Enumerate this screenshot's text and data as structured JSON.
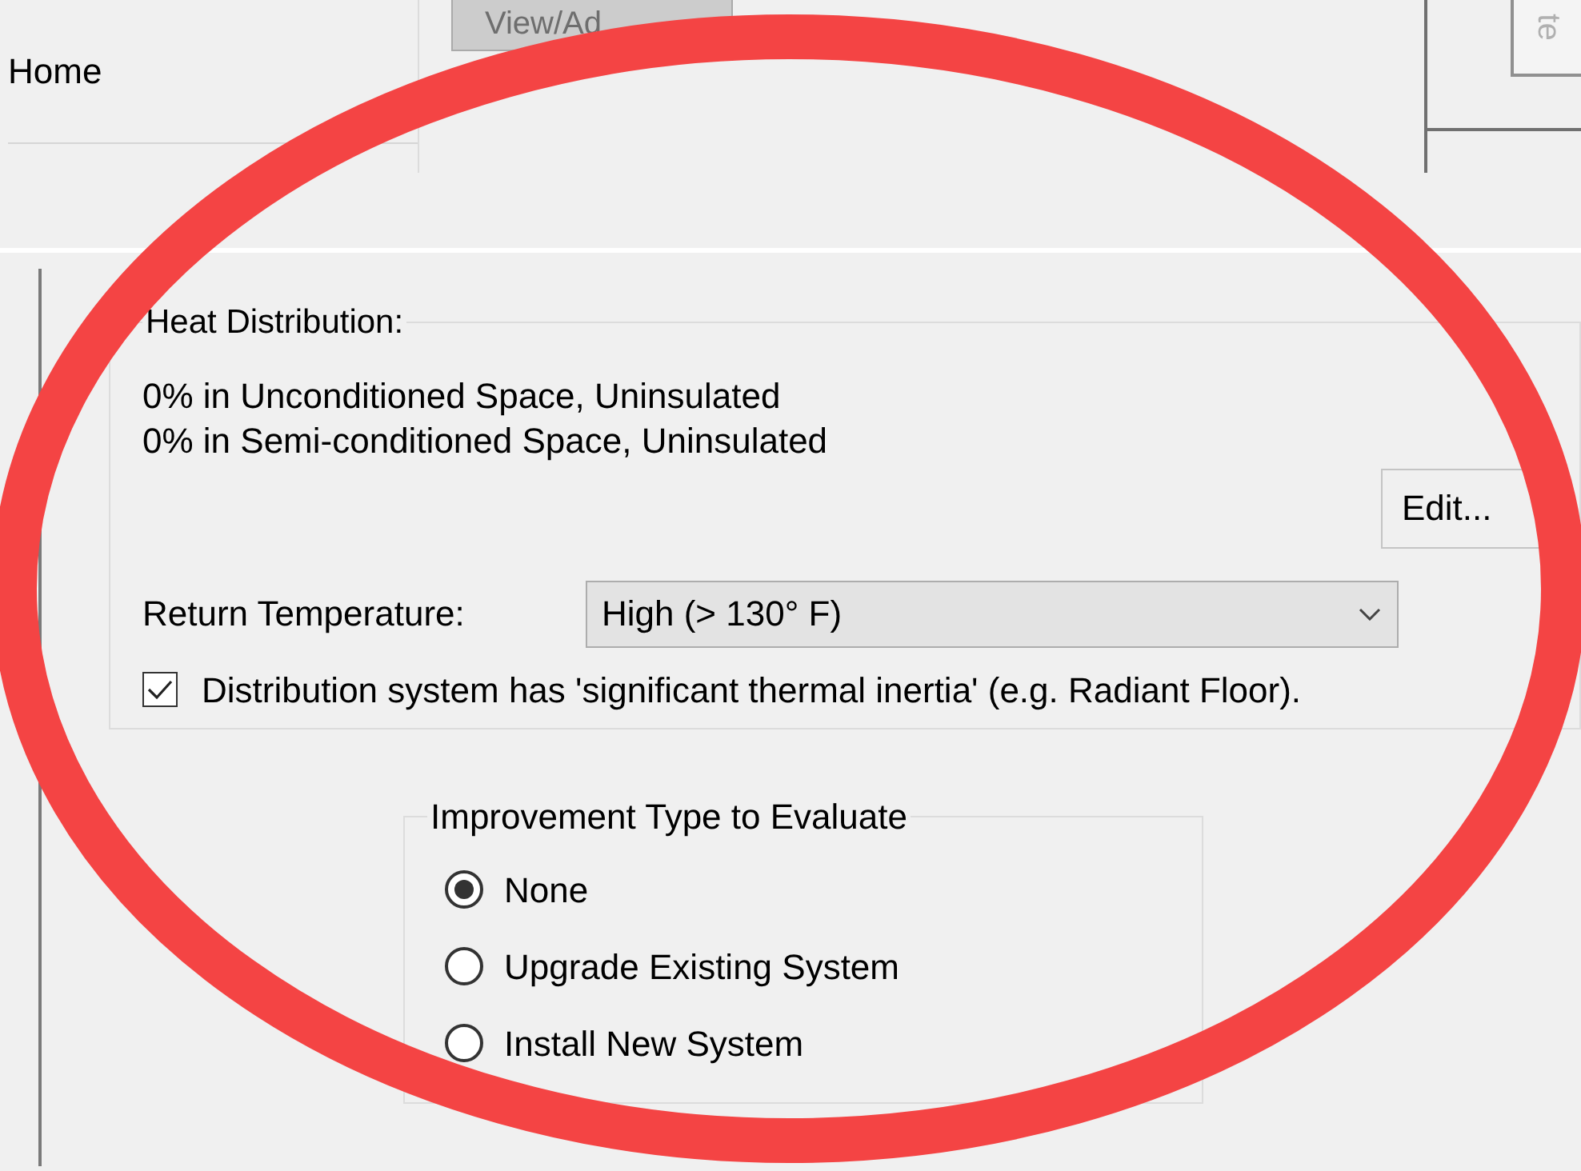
{
  "nav": {
    "home_label": "Home",
    "view_button": {
      "label": "View/Ad",
      "disabled": true
    },
    "side_tab": "te"
  },
  "heat_distribution": {
    "title": "Heat Distribution:",
    "lines": [
      "0% in Unconditioned Space, Uninsulated",
      "0% in Semi-conditioned Space, Uninsulated"
    ],
    "edit_button": "Edit...",
    "return_temperature": {
      "label": "Return Temperature:",
      "value": "High (> 130° F)"
    },
    "thermal_inertia": {
      "label": "Distribution system has 'significant thermal inertia' (e.g. Radiant Floor).",
      "checked": true
    }
  },
  "improvement_type": {
    "title": "Improvement Type to Evaluate",
    "options": [
      {
        "label": "None",
        "selected": true
      },
      {
        "label": "Upgrade Existing System",
        "selected": false
      },
      {
        "label": "Install New System",
        "selected": false
      }
    ]
  },
  "annotation": {
    "kind": "ellipse"
  }
}
